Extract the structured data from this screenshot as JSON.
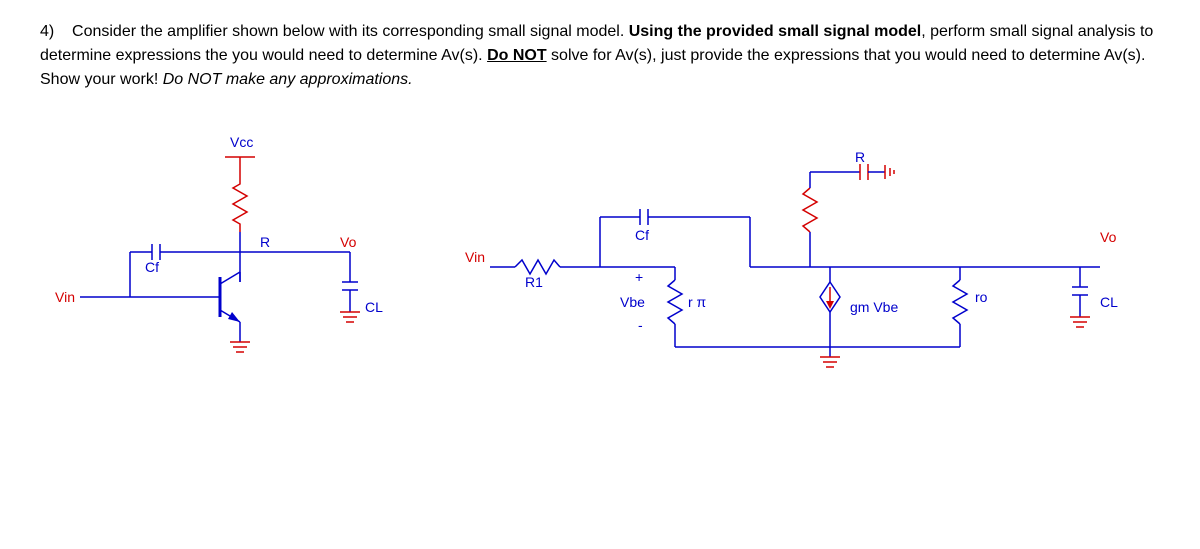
{
  "question": {
    "number": "4)",
    "line1_plain": "Consider the amplifier shown below with its corresponding small signal model. ",
    "line1_bold": "Using the provided small signal model",
    "line2_prefix": ", perform small signal analysis to determine expressions the you would need to determine Av(s). ",
    "line2_bold_u": "Do NOT",
    "line3_prefix": " solve for Av(s), just provide the expressions that you would need to determine Av(s). Show your work! ",
    "line3_italic": "Do NOT make any approximations."
  },
  "circuit1": {
    "vcc": "Vcc",
    "r": "R",
    "cf": "Cf",
    "vin": "Vin",
    "vo": "Vo",
    "cl": "CL"
  },
  "circuit2": {
    "vin": "Vin",
    "r1": "R1",
    "cf": "Cf",
    "vbe_plus": "+",
    "vbe": "Vbe",
    "vbe_minus": "-",
    "rpi": "r π",
    "r": "R",
    "gmvbe": "gm Vbe",
    "ro": "ro",
    "vo": "Vo",
    "cl": "CL"
  }
}
